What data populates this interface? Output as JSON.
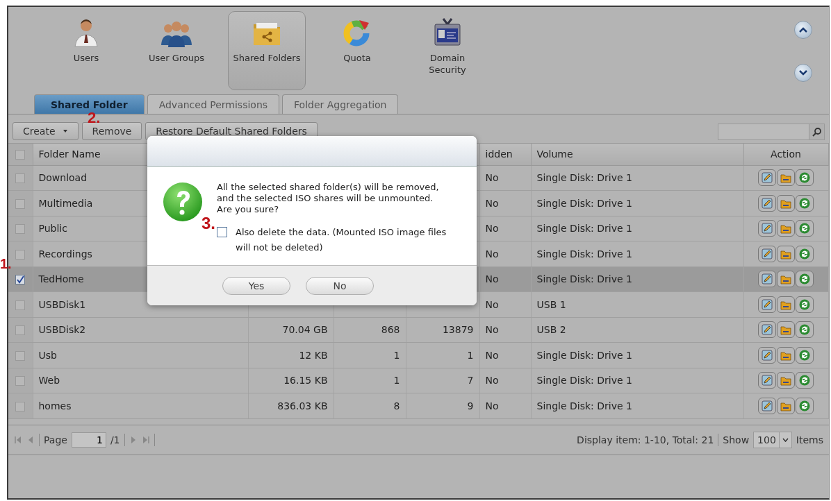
{
  "nav": {
    "items": [
      {
        "label": "Users",
        "selected": false
      },
      {
        "label": "User Groups",
        "selected": false
      },
      {
        "label": "Shared Folders",
        "selected": true
      },
      {
        "label": "Quota",
        "selected": false
      },
      {
        "label": "Domain Security",
        "selected": false
      }
    ]
  },
  "tabs": [
    {
      "label": "Shared Folder",
      "selected": true
    },
    {
      "label": "Advanced Permissions",
      "selected": false
    },
    {
      "label": "Folder Aggregation",
      "selected": false
    }
  ],
  "toolbar": {
    "buttons": [
      {
        "label": "Create",
        "kind": "dropdown"
      },
      {
        "label": "Remove",
        "kind": "plain"
      },
      {
        "label": "Restore Default Shared Folders",
        "kind": "plain"
      }
    ]
  },
  "table": {
    "select_all_checked": false,
    "columns": [
      "Folder Name",
      "idden",
      "Volume",
      "Action"
    ],
    "rows": [
      {
        "name": "Download",
        "hidden": "No",
        "volume": "Single Disk: Drive 1",
        "checked": false,
        "selected": false
      },
      {
        "name": "Multimedia",
        "hidden": "No",
        "volume": "Single Disk: Drive 1",
        "checked": false,
        "selected": false
      },
      {
        "name": "Public",
        "hidden": "No",
        "volume": "Single Disk: Drive 1",
        "checked": false,
        "selected": false
      },
      {
        "name": "Recordings",
        "hidden": "No",
        "volume": "Single Disk: Drive 1",
        "checked": false,
        "selected": false
      },
      {
        "name": "TedHome",
        "hidden": "No",
        "volume": "Single Disk: Drive 1",
        "checked": true,
        "selected": true
      },
      {
        "name": "USBDisk1",
        "hidden": "No",
        "volume": "USB 1",
        "checked": false,
        "selected": false
      },
      {
        "name": "USBDisk2",
        "stats": [
          "70.04 GB",
          "868",
          "13879"
        ],
        "hidden": "No",
        "volume": "USB 2",
        "checked": false,
        "selected": false
      },
      {
        "name": "Usb",
        "stats": [
          "12 KB",
          "1",
          "1"
        ],
        "hidden": "No",
        "volume": "Single Disk: Drive 1",
        "checked": false,
        "selected": false
      },
      {
        "name": "Web",
        "stats": [
          "16.15 KB",
          "1",
          "7"
        ],
        "hidden": "No",
        "volume": "Single Disk: Drive 1",
        "checked": false,
        "selected": false
      },
      {
        "name": "homes",
        "stats": [
          "836.03 KB",
          "8",
          "9"
        ],
        "hidden": "No",
        "volume": "Single Disk: Drive 1",
        "checked": false,
        "selected": false
      }
    ]
  },
  "pager": {
    "page_label": "Page",
    "page": "1",
    "of": "/1",
    "display": "Display item: 1-10, Total: 21",
    "show_label": "Show",
    "per_page": "100",
    "items_label": "Items"
  },
  "dialog": {
    "message": "All the selected shared folder(s) will be removed, and the selected ISO shares will be unmounted. Are you sure?",
    "option": {
      "label": "Also delete the data. (Mounted ISO image files will not be deleted)",
      "checked": false
    },
    "buttons": [
      "Yes",
      "No"
    ]
  },
  "markers": {
    "row": "1.",
    "toolbar": "2.",
    "dialog": "3."
  }
}
